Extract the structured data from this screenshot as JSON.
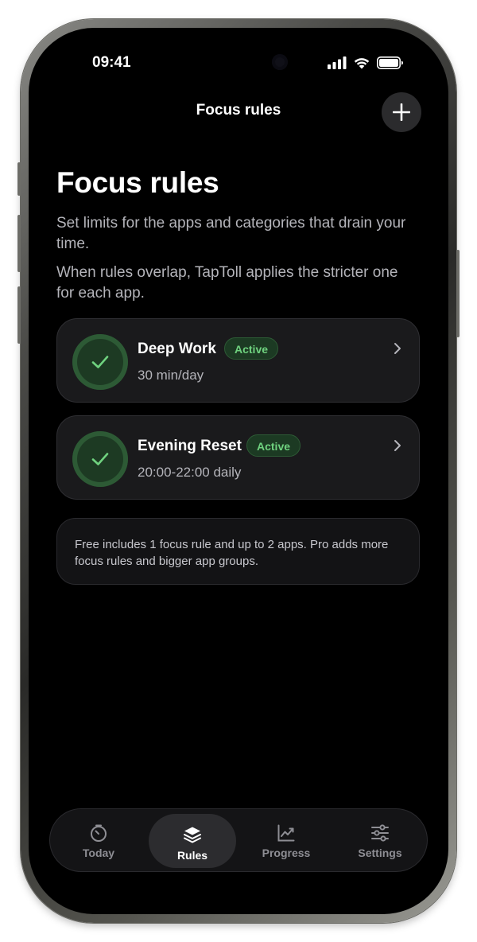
{
  "status_bar": {
    "time": "09:41"
  },
  "nav": {
    "title": "Focus rules"
  },
  "page": {
    "title": "Focus rules",
    "description_1": "Set limits for the apps and categories that drain your time.",
    "description_2": "When rules overlap, TapToll applies the stricter one for each app."
  },
  "rules": [
    {
      "name": "Deep Work",
      "badge": "Active",
      "detail": "30 min/day"
    },
    {
      "name": "Evening Reset",
      "badge": "Active",
      "detail": "20:00-22:00 daily"
    }
  ],
  "info": {
    "text": "Free includes 1 focus rule and up to 2 apps. Pro adds more focus rules and bigger app groups."
  },
  "tabs": [
    {
      "label": "Today",
      "icon": "timer-icon",
      "selected": false
    },
    {
      "label": "Rules",
      "icon": "layers-icon",
      "selected": true
    },
    {
      "label": "Progress",
      "icon": "chart-icon",
      "selected": false
    },
    {
      "label": "Settings",
      "icon": "sliders-icon",
      "selected": false
    }
  ],
  "colors": {
    "accent_green": "#6fd27f",
    "background": "#000000",
    "card": "#1a1a1c"
  }
}
